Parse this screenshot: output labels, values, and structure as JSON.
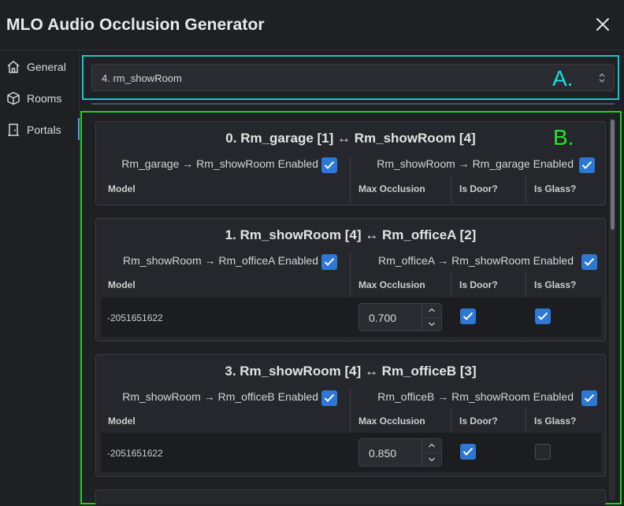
{
  "window": {
    "title": "MLO Audio Occlusion Generator"
  },
  "sidebar": {
    "items": [
      {
        "label": "General",
        "icon": "home-icon"
      },
      {
        "label": "Rooms",
        "icon": "cube-icon"
      },
      {
        "label": "Portals",
        "icon": "door-icon"
      }
    ]
  },
  "room_select": {
    "value": "4. rm_showRoom"
  },
  "annotations": {
    "a": "A.",
    "b": "B."
  },
  "columns": {
    "model": "Model",
    "max_occlusion": "Max Occlusion",
    "is_door": "Is Door?",
    "is_glass": "Is Glass?"
  },
  "portals": [
    {
      "title": "0. Rm_garage [1] ↔ Rm_showRoom [4]",
      "left_label": "Rm_garage → Rm_showRoom Enabled",
      "left_enabled": true,
      "right_label": "Rm_showRoom → Rm_garage Enabled",
      "right_enabled": true,
      "rows": []
    },
    {
      "title": "1. Rm_showRoom [4] ↔ Rm_officeA [2]",
      "left_label": "Rm_showRoom → Rm_officeA Enabled",
      "left_enabled": true,
      "right_label": "Rm_officeA → Rm_showRoom Enabled",
      "right_enabled": true,
      "rows": [
        {
          "model": "-2051651622",
          "max_occlusion": "0.700",
          "is_door": true,
          "is_glass": true
        }
      ]
    },
    {
      "title": "3. Rm_showRoom [4] ↔ Rm_officeB [3]",
      "left_label": "Rm_showRoom → Rm_officeB Enabled",
      "left_enabled": true,
      "right_label": "Rm_officeB → Rm_showRoom Enabled",
      "right_enabled": true,
      "rows": [
        {
          "model": "-2051651622",
          "max_occlusion": "0.850",
          "is_door": true,
          "is_glass": false
        }
      ]
    }
  ],
  "colors": {
    "accent": "#2d78d2",
    "box_a": "#17c6cf",
    "box_b": "#1fd11f"
  }
}
